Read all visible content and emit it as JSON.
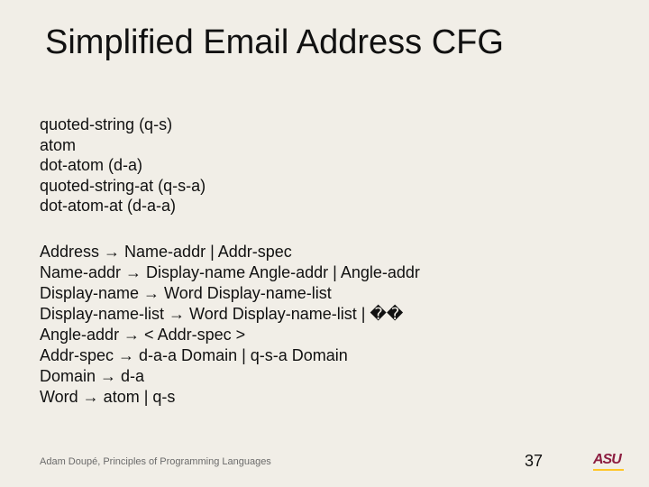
{
  "title": "Simplified Email Address CFG",
  "defs": [
    "quoted-string (q-s)",
    "atom",
    "dot-atom (d-a)",
    "quoted-string-at (q-s-a)",
    "dot-atom-at (d-a-a)"
  ],
  "rules": [
    "Address → Name-addr | Addr-spec",
    "Name-addr → Display-name Angle-addr | Angle-addr",
    "Display-name → Word Display-name-list",
    "Display-name-list → Word Display-name-list | ��",
    "Angle-addr → < Addr-spec >",
    "Addr-spec → d-a-a Domain | q-s-a Domain",
    "Domain → d-a",
    "Word → atom | q-s"
  ],
  "footer": "Adam Doupé, Principles of Programming Languages",
  "page": "37",
  "logo_text": "ASU"
}
